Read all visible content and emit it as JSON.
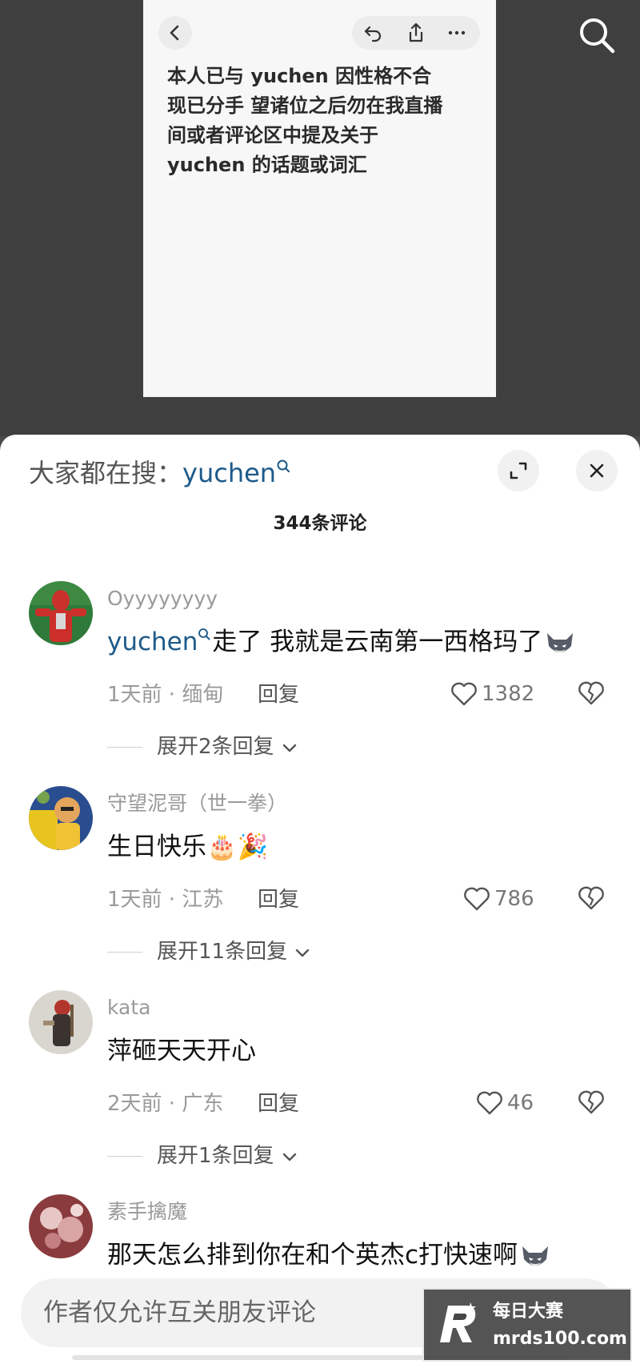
{
  "note": {
    "lines": [
      "本人已与 yuchen 因性格不合",
      "现已分手 望诸位之后勿在我直播",
      "间或者评论区中提及关于",
      "yuchen 的话题或词汇"
    ],
    "icons": [
      "back-icon",
      "undo-icon",
      "share-icon",
      "more-icon"
    ]
  },
  "top_search_icon": "search-icon",
  "sheet": {
    "hot_search_label": "大家都在搜：",
    "hot_search_keyword": "yuchen",
    "comment_count": "344条评论"
  },
  "comments": [
    {
      "username": "Oyyyyyyyy",
      "text_keyword": "yuchen",
      "text": "走了 我就是云南第一西格玛了",
      "emoji": "wolf-emoji",
      "meta": "1天前 · 缅甸",
      "reply": "回复",
      "likes": "1382",
      "expand": "展开2条回复"
    },
    {
      "username": "守望泥哥（世一拳）",
      "text": "生日快乐🎂🎉",
      "meta": "1天前 · 江苏",
      "reply": "回复",
      "likes": "786",
      "expand": "展开11条回复"
    },
    {
      "username": "kata",
      "text": "萍砸天天开心",
      "meta": "2天前 · 广东",
      "reply": "回复",
      "likes": "46",
      "expand": "展开1条回复"
    },
    {
      "username": "素手擒魔",
      "text": "那天怎么排到你在和个英杰c打快速啊",
      "emoji": "wolf-emoji"
    }
  ],
  "input": {
    "placeholder": "作者仅允许互关朋友评论"
  },
  "watermark": {
    "line1": "每日大赛",
    "line2": "mrds100.com"
  },
  "colors": {
    "keyword": "#1d5a8a",
    "muted": "#9a9a9a",
    "sheet_bg": "#ffffff",
    "backdrop": "#3f3f3f"
  }
}
